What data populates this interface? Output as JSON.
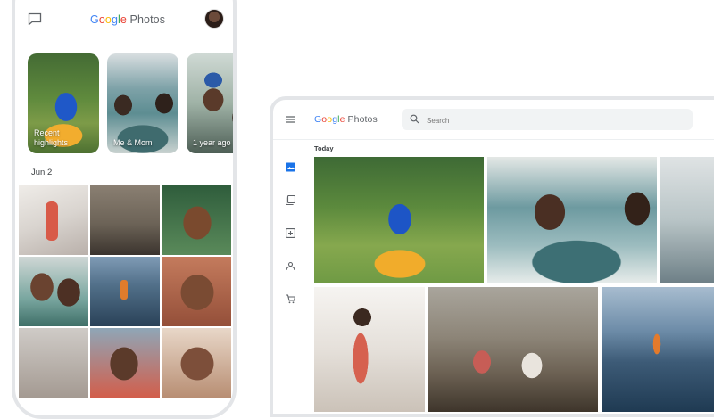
{
  "phone": {
    "logo": {
      "g1": "G",
      "g2": "o",
      "g3": "o",
      "g4": "g",
      "g5": "l",
      "g6": "e",
      "product": " Photos"
    },
    "memories": [
      {
        "caption_line1": "Recent",
        "caption_line2": "highlights"
      },
      {
        "caption_line1": "",
        "caption_line2": "Me & Mom"
      },
      {
        "caption_line1": "",
        "caption_line2": "1 year ago"
      }
    ],
    "date_label": "Jun 2",
    "icons": {
      "chat": "chat-icon",
      "avatar": "avatar"
    }
  },
  "tablet": {
    "logo": {
      "g1": "G",
      "g2": "o",
      "g3": "o",
      "g4": "g",
      "g5": "l",
      "g6": "e",
      "product": " Photos"
    },
    "search": {
      "placeholder": "Search"
    },
    "section_label": "Today",
    "nav_icons": [
      "photos-icon",
      "albums-icon",
      "utilities-icon",
      "sharing-icon",
      "print-store-icon"
    ]
  },
  "colors": {
    "accent_blue": "#4285f4",
    "red": "#ea4335",
    "yellow": "#fbbc05",
    "green": "#34a853",
    "nav_active": "#1a73e8",
    "nav_inactive": "#5f6368"
  }
}
